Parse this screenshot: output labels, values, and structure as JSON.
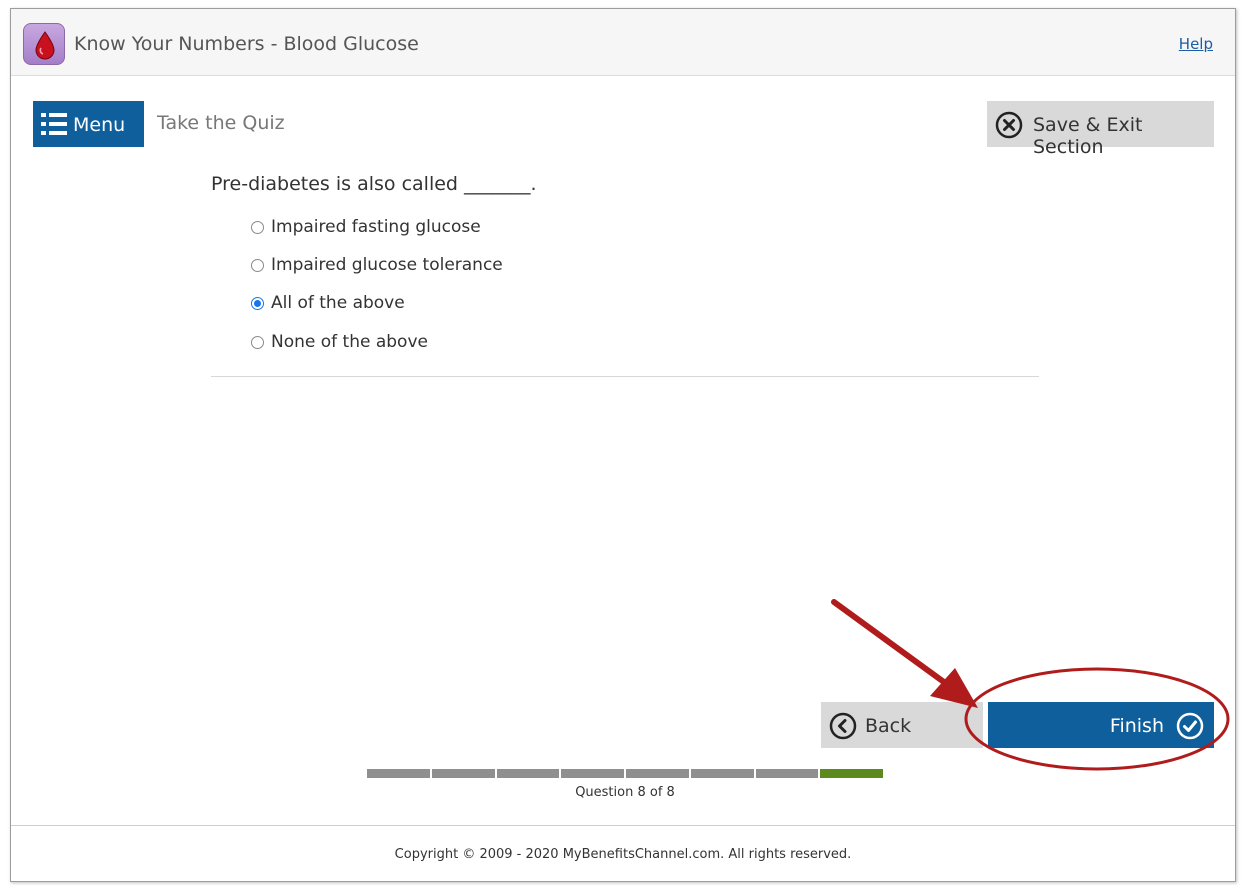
{
  "header": {
    "app_title": "Know Your Numbers - Blood Glucose",
    "help_label": "Help"
  },
  "toolbar": {
    "menu_label": "Menu",
    "section_title": "Take the Quiz",
    "save_exit_label": "Save & Exit Section"
  },
  "quiz": {
    "question": "Pre-diabetes is also called _______.",
    "options": [
      {
        "label": "Impaired fasting glucose",
        "selected": false
      },
      {
        "label": "Impaired glucose tolerance",
        "selected": false
      },
      {
        "label": "All of the above",
        "selected": true
      },
      {
        "label": "None of the above",
        "selected": false
      }
    ]
  },
  "navigation": {
    "back_label": "Back",
    "finish_label": "Finish"
  },
  "progress": {
    "text": "Question 8 of 8",
    "current": 8,
    "total": 8
  },
  "footer": {
    "copyright": "Copyright © 2009 - 2020 MyBenefitsChannel.com. All rights reserved."
  },
  "icons": {
    "app": "blood-drop-icon",
    "menu": "list-icon",
    "save_exit": "close-circle-icon",
    "back": "chevron-left-circle-icon",
    "finish": "check-circle-icon"
  },
  "colors": {
    "primary_button": "#0e5f9c",
    "secondary_button": "#d9d9d9",
    "progress_done": "#8f8f8f",
    "progress_current": "#5c8a1e",
    "annotation": "#b01c1c"
  }
}
